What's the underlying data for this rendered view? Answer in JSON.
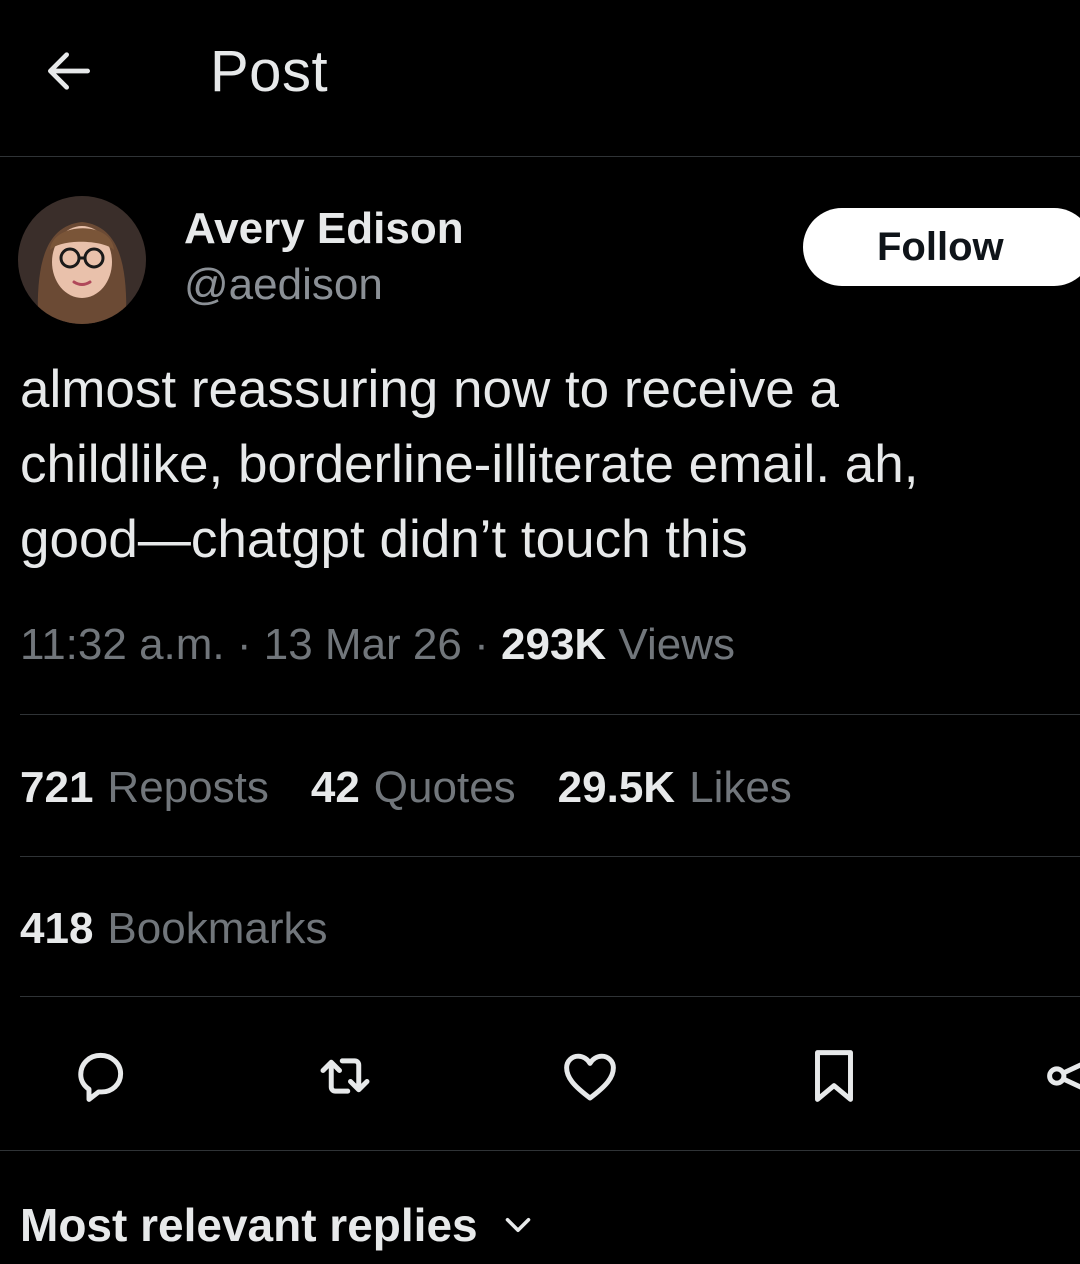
{
  "header": {
    "title": "Post",
    "back_icon": "arrow-left-icon"
  },
  "author": {
    "name": "Avery Edison",
    "handle": "@aedison",
    "follow_label": "Follow"
  },
  "post": {
    "text": "almost reassuring now to receive a\nchildlike, borderline-illiterate email. ah,\ngood—chatgpt didn’t touch this",
    "time": "11:32 a.m.",
    "date": "13 Mar 26",
    "views_count": "293K",
    "views_label": "Views",
    "separator": "·"
  },
  "stats": {
    "reposts_count": "721",
    "reposts_label": "Reposts",
    "quotes_count": "42",
    "quotes_label": "Quotes",
    "likes_count": "29.5K",
    "likes_label": "Likes",
    "bookmarks_count": "418",
    "bookmarks_label": "Bookmarks"
  },
  "actions": {
    "icons": [
      "reply-icon",
      "repost-icon",
      "like-icon",
      "bookmark-icon",
      "share-icon"
    ]
  },
  "replies": {
    "sort_label": "Most relevant replies"
  },
  "colors": {
    "background": "#000000",
    "text_primary": "#e7e9ea",
    "text_secondary": "#71767b",
    "divider": "#2f3336",
    "follow_bg": "#ffffff"
  }
}
